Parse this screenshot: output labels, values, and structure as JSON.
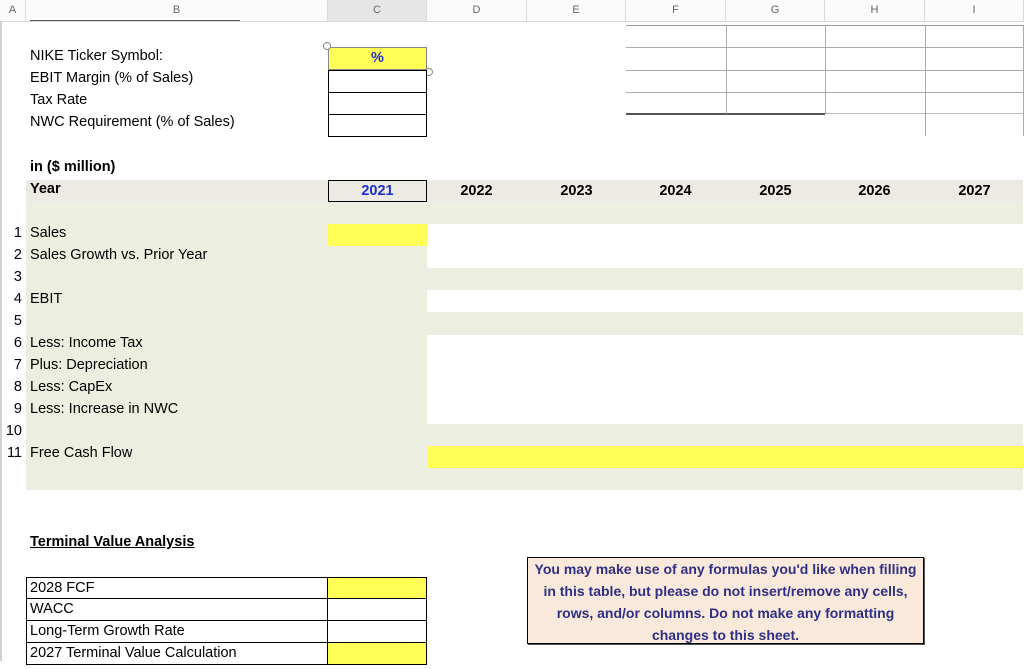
{
  "columns": [
    "A",
    "B",
    "C",
    "D",
    "E",
    "F",
    "G",
    "H",
    "I"
  ],
  "selected_column": "C",
  "inputs": {
    "rows": [
      {
        "label": "NIKE Ticker Symbol:",
        "value": "%"
      },
      {
        "label": "EBIT Margin (% of Sales)",
        "value": ""
      },
      {
        "label": "Tax Rate",
        "value": ""
      },
      {
        "label": "NWC Requirement (% of Sales)",
        "value": ""
      }
    ]
  },
  "table": {
    "units_label": "in ($ million)",
    "year_label": "Year",
    "years": [
      "2021",
      "2022",
      "2023",
      "2024",
      "2025",
      "2026",
      "2027"
    ],
    "rows": [
      {
        "num": "1",
        "label": "Sales"
      },
      {
        "num": "2",
        "label": "Sales Growth vs. Prior Year"
      },
      {
        "num": "3",
        "label": ""
      },
      {
        "num": "4",
        "label": "EBIT"
      },
      {
        "num": "5",
        "label": ""
      },
      {
        "num": "6",
        "label": "Less: Income Tax"
      },
      {
        "num": "7",
        "label": "Plus: Depreciation"
      },
      {
        "num": "8",
        "label": "Less: CapEx"
      },
      {
        "num": "9",
        "label": "Less: Increase in NWC"
      },
      {
        "num": "10",
        "label": ""
      },
      {
        "num": "11",
        "label": "Free Cash Flow"
      }
    ]
  },
  "terminal": {
    "title": "Terminal Value Analysis",
    "rows": [
      {
        "label": "2028 FCF",
        "value": ""
      },
      {
        "label": "WACC",
        "value": ""
      },
      {
        "label": "Long-Term Growth Rate",
        "value": ""
      },
      {
        "label": "2027 Terminal Value Calculation",
        "value": ""
      }
    ]
  },
  "note": "You may make use of any formulas you'd like when filling in this table, but please do not insert/remove any cells, rows, and/or columns.  Do not make any formatting changes to this sheet.",
  "colors": {
    "highlight_yellow": "#ffff55",
    "band_green": "#ecefe0",
    "year_header_band": "#eceae2",
    "year_2021_blue": "#1f2fcf",
    "note_bg": "#fbeadb",
    "note_text": "#2e2f86"
  }
}
